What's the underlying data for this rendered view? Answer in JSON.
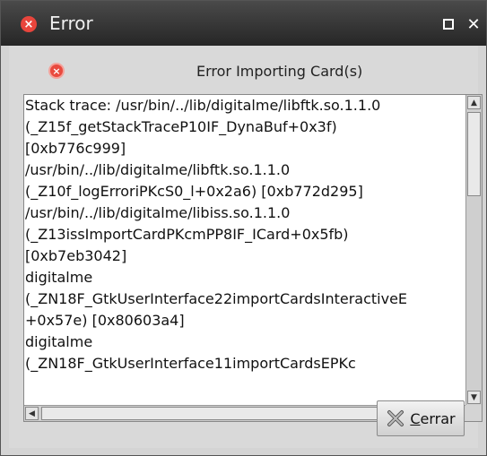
{
  "window": {
    "title": "Error",
    "maximize_label": "",
    "close_label": "✕"
  },
  "dialog": {
    "message": "Error Importing Card(s)",
    "trace_lines": [
      "Stack trace: /usr/bin/../lib/digitalme/libftk.so.1.1.0",
      "(_Z15f_getStackTraceP10IF_DynaBuf+0x3f)",
      "[0xb776c999]",
      "/usr/bin/../lib/digitalme/libftk.so.1.1.0",
      "(_Z10f_logErroriPKcS0_l+0x2a6) [0xb772d295]",
      "/usr/bin/../lib/digitalme/libiss.so.1.1.0",
      "(_Z13issImportCardPKcmPP8IF_ICard+0x5fb)",
      "[0xb7eb3042]",
      "digitalme",
      "(_ZN18F_GtkUserInterface22importCardsInteractiveE",
      "+0x57e) [0x80603a4]",
      "digitalme",
      "(_ZN18F_GtkUserInterface11importCardsEPKc"
    ],
    "close_button": {
      "mnemonic": "C",
      "rest": "errar"
    }
  },
  "icons": {
    "title": "error-icon",
    "message": "error-icon",
    "close_button": "close-x-icon"
  },
  "colors": {
    "titlebar": "#2e2e2e",
    "error_red": "#e8453c",
    "background": "#d9d9d9"
  }
}
